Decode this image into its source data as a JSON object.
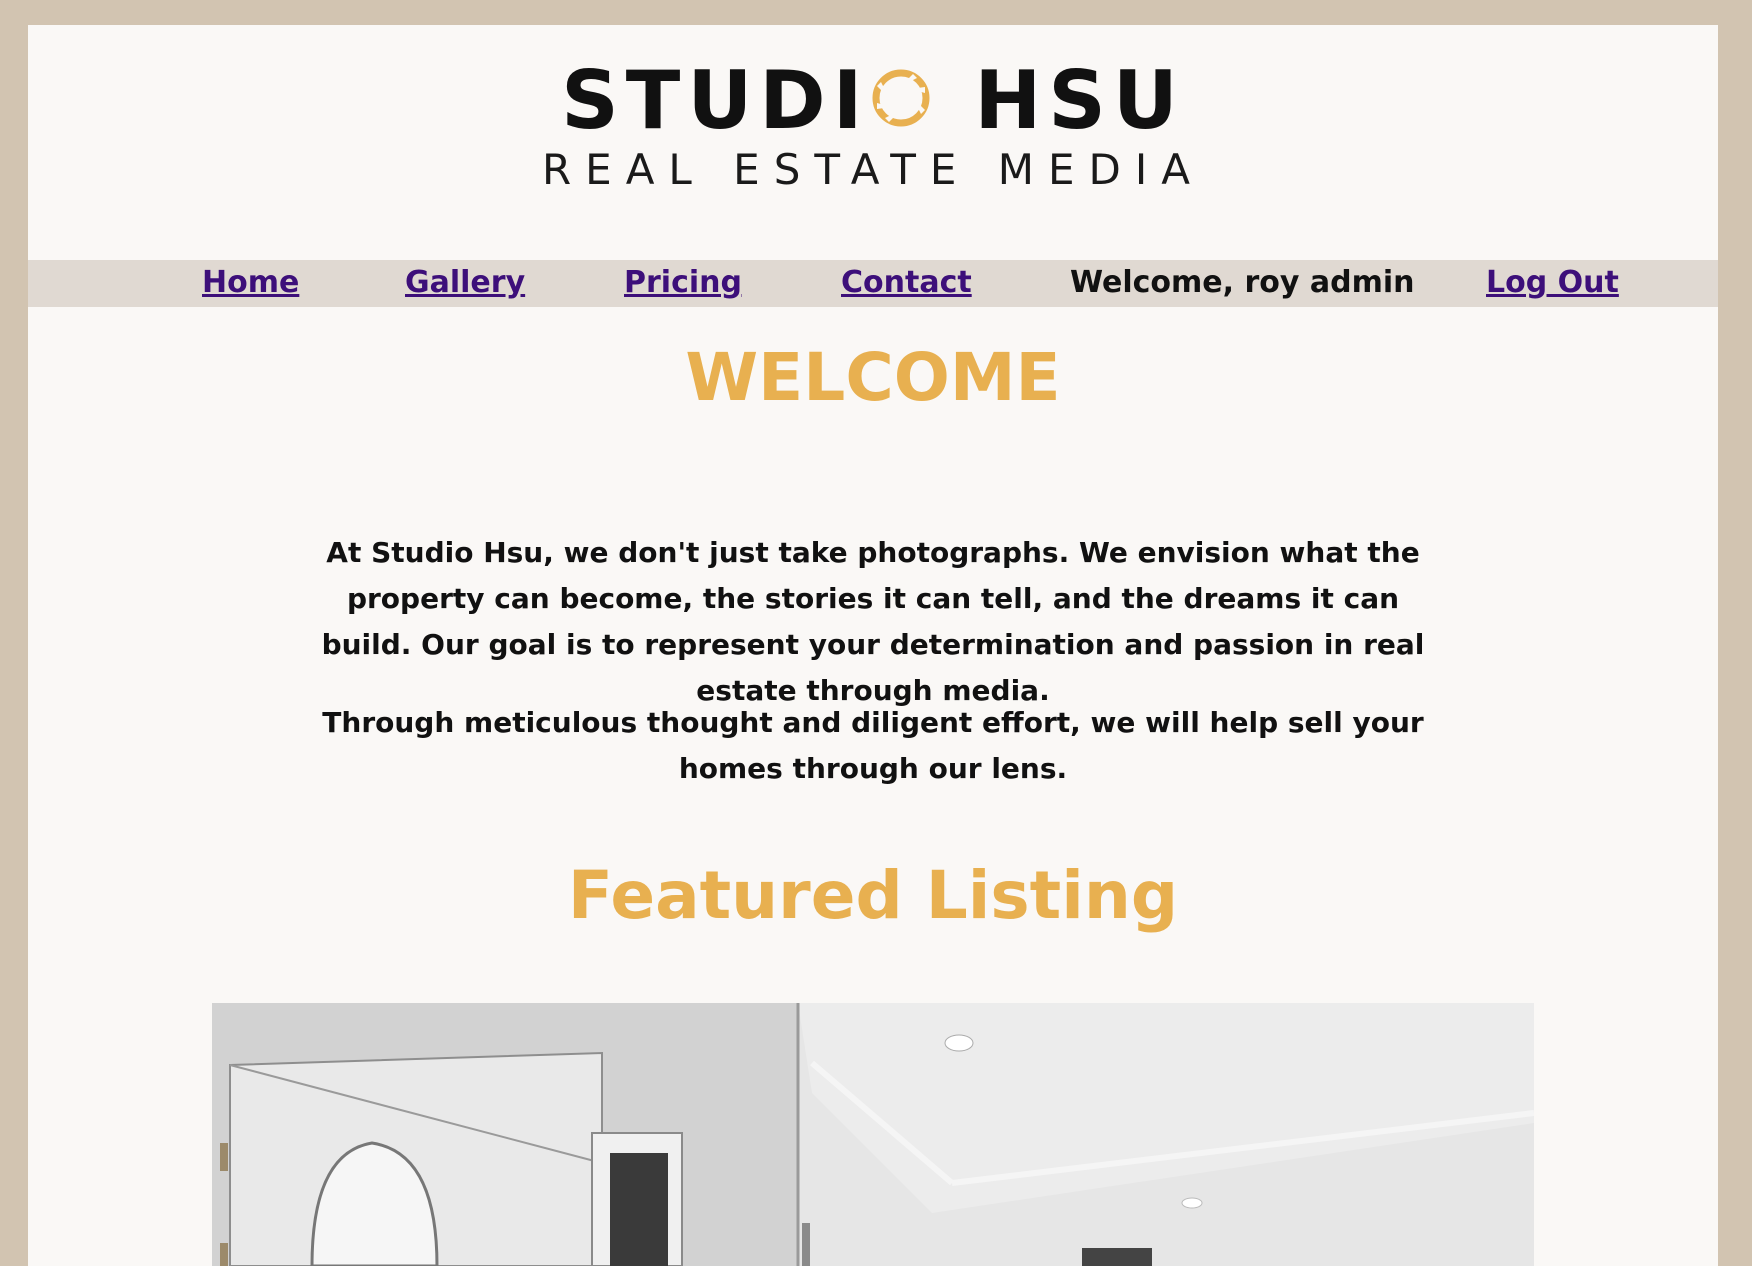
{
  "logo": {
    "line1_left": "STUDI",
    "line1_right": "HSU",
    "line2": "REAL ESTATE MEDIA",
    "aperture_color": "#e8b050"
  },
  "nav": {
    "items": [
      {
        "label": "Home"
      },
      {
        "label": "Gallery"
      },
      {
        "label": "Pricing"
      },
      {
        "label": "Contact"
      }
    ],
    "welcome_text": "Welcome, roy admin",
    "logout_label": "Log Out"
  },
  "main": {
    "welcome_heading": "WELCOME",
    "intro_paragraph_1": "At Studio Hsu, we don't just take photographs. We envision what the property can become, the stories it can tell, and the dreams it can build. Our goal is to represent your determination and passion in real estate through media.",
    "intro_paragraph_2": "Through meticulous thought and diligent effort, we will help sell your homes through our lens.",
    "featured_heading": "Featured Listing"
  },
  "colors": {
    "accent": "#e8b050",
    "link": "#3d0f7a",
    "frame": "#d2c4b1",
    "nav_bar": "#e0d9d2"
  }
}
